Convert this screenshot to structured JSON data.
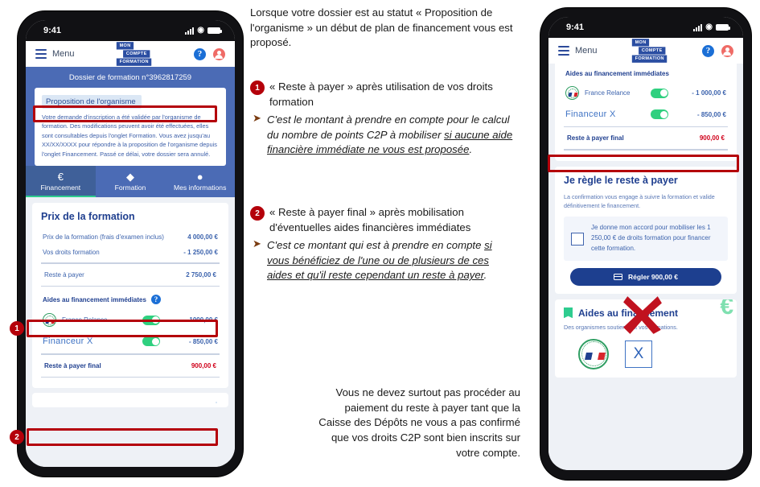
{
  "status_bar": {
    "time": "9:41",
    "signal_icon": "cellular-signal-icon",
    "wifi_icon": "wifi-icon",
    "battery_icon": "battery-icon"
  },
  "app_header": {
    "menu_label": "Menu",
    "logo_line1": "MON",
    "logo_line2": "COMPTE",
    "logo_line3": "FORMATION",
    "help_glyph": "?",
    "help_icon_name": "help-icon",
    "account_icon_name": "user-account-icon"
  },
  "left_phone": {
    "banner_title": "Dossier de formation n°3962817259",
    "status_chip": "Proposition de l'organisme",
    "status_text": "Votre demande d'inscription a été validée par l'organisme de formation. Des modifications peuvent avoir été effectuées, elles sont consultables depuis l'onglet Formation. Vous avez jusqu'au XX/XX/XXXX pour répondre à la proposition de l'organisme depuis l'onglet Financement. Passé ce délai, votre dossier sera annulé.",
    "tabs": [
      {
        "label": "Financement",
        "icon": "euro-icon",
        "glyph": "€",
        "active": true
      },
      {
        "label": "Formation",
        "icon": "graduation-cap-icon",
        "glyph": "♣",
        "active": false
      },
      {
        "label": "Mes informations",
        "icon": "person-icon",
        "glyph": "●",
        "active": false
      }
    ],
    "price_card": {
      "title": "Prix de la formation",
      "rows": [
        {
          "label": "Prix de la formation (frais d'examen inclus)",
          "value": "4 000,00 €"
        },
        {
          "label": "Vos droits formation",
          "value": "- 1 250,00 €"
        }
      ],
      "reste_label": "Reste à payer",
      "reste_value": "2 750,00 €",
      "aides_label": "Aides au financement immédiates",
      "aides": [
        {
          "name": "France Relance",
          "amount": "- 1000,00 €",
          "toggle": "on",
          "logo": "france-relance-logo"
        },
        {
          "name": "Financeur X",
          "amount": "- 850,00 €",
          "toggle": "on",
          "logo": "text-logo"
        }
      ],
      "final_label": "Reste à payer final",
      "final_value": "900,00 €"
    }
  },
  "right_phone": {
    "aides_label": "Aides au financement immédiates",
    "aides": [
      {
        "name": "France Relance",
        "amount": "- 1 000,00 €",
        "toggle": "on",
        "logo": "france-relance-logo"
      },
      {
        "name": "Financeur X",
        "amount": "- 850,00 €",
        "toggle": "on",
        "logo": "text-logo"
      }
    ],
    "final_label": "Reste à payer final",
    "final_value": "900,00 €",
    "settle_card": {
      "title": "Je règle le reste à payer",
      "subtitle": "La confirmation vous engage à suivre la formation et valide définitivement le financement.",
      "checkbox_text": "Je donne mon accord pour mobiliser les 1 250,00 € de droits formation pour financer cette formation.",
      "checkbox_checked": false,
      "pay_button_label": "Régler 900,00 €",
      "pay_button_icon": "credit-card-icon"
    },
    "aides_card": {
      "title": "Aides au financement",
      "subtitle": "Des organismes soutiennent vos formations.",
      "tag_icon": "bookmark-tag-icon",
      "watermark": "€",
      "logos": [
        {
          "name": "France Relance",
          "type": "france-relance-logo"
        },
        {
          "name": "Financeur X",
          "type": "x-logo",
          "glyph": "X"
        }
      ]
    }
  },
  "annotations": {
    "intro": "Lorsque votre dossier est au statut « Proposition de l'organisme » un début de plan de financement vous est proposé.",
    "badge1": "1",
    "badge2": "2",
    "item1_head": "« Reste à payer » après utilisation de vos droits formation",
    "item1_sub_plain": "C'est le montant à prendre en compte pour le calcul du nombre de points C2P à mobiliser ",
    "item1_sub_underline": "si aucune aide financière immédiate ne vous est proposée",
    "item1_sub_end": ".",
    "item2_head": "« Reste à payer final » après mobilisation d'éventuelles aides financières immédiates",
    "item2_sub_plain": "C'est ce montant qui est à prendre en compte ",
    "item2_sub_underline": "si vous bénéficiez de l'une ou de plusieurs de ces aides et qu'il reste cependant un reste à payer",
    "item2_sub_end": ".",
    "arrow_glyph": "➤",
    "warning": "Vous ne devez surtout pas procéder au paiement du reste à payer tant que la Caisse des Dépôts ne vous a pas confirmé que vos droits C2P sont bien inscrits sur votre compte.",
    "red_x_icon": "red-cross-out-icon"
  },
  "colors": {
    "brand_blue": "#1f3f8f",
    "banner_blue": "#4b6bb5",
    "accent_green": "#2ecc8f",
    "alert_red": "#b4000a",
    "amount_red": "#d0021b"
  }
}
